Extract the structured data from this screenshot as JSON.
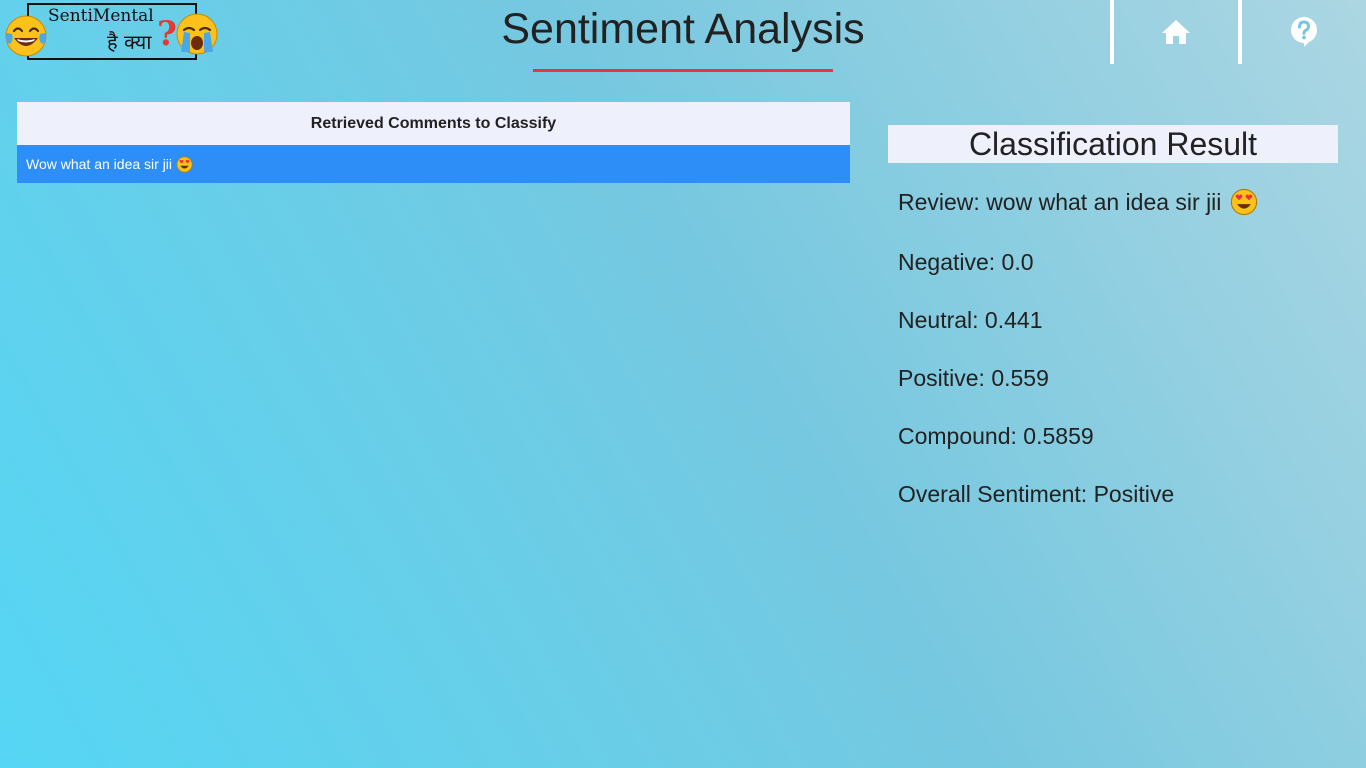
{
  "logo": {
    "line1": "SentiMental",
    "line2": "है क्या",
    "qmark": "?",
    "left_icon": "tears-of-joy-emoji-icon",
    "right_icon": "loudly-crying-emoji-icon"
  },
  "header": {
    "title": "Sentiment Analysis",
    "nav": [
      {
        "icon": "home-icon"
      },
      {
        "icon": "help-icon"
      }
    ]
  },
  "comments": {
    "title": "Retrieved Comments to Classify",
    "items": [
      {
        "text": "Wow what an idea sir jii",
        "emoji": "heart-eyes-emoji-icon"
      }
    ]
  },
  "result": {
    "title": "Classification Result",
    "review": "Review: wow what an idea sir jii",
    "review_emoji": "heart-eyes-emoji-icon",
    "negative": "Negative: 0.0",
    "neutral": "Neutral: 0.441",
    "positive": "Positive: 0.559",
    "compound": "Compound: 0.5859",
    "overall": "Overall Sentiment: Positive"
  },
  "colors": {
    "accent_red": "#e53935",
    "selected_row": "#2d8ef8",
    "panel_header_bg": "#eef0fb"
  }
}
